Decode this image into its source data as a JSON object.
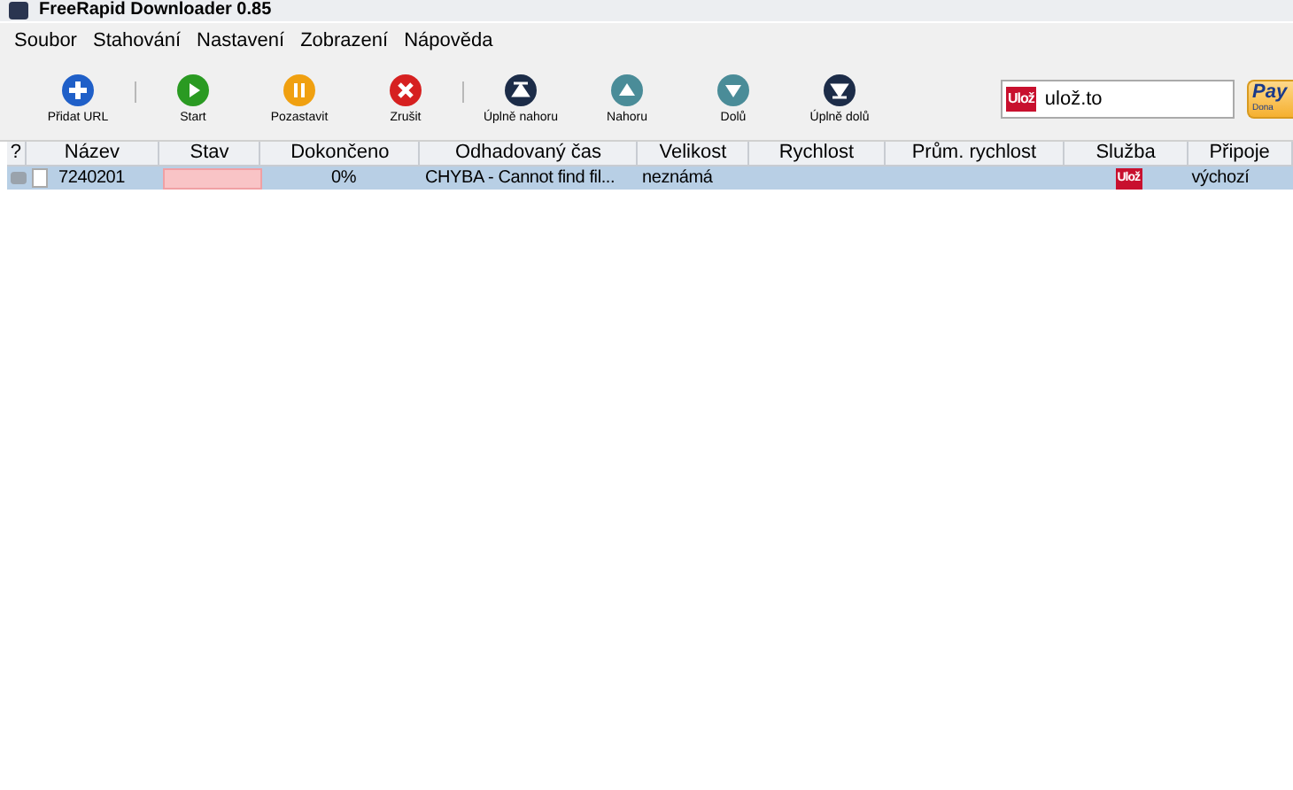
{
  "window": {
    "title": "FreeRapid Downloader 0.85"
  },
  "menu": [
    "Soubor",
    "Stahování",
    "Nastavení",
    "Zobrazení",
    "Nápověda"
  ],
  "toolbar": [
    {
      "kind": "add",
      "label": "Přidat URL",
      "separator_after": true
    },
    {
      "kind": "start",
      "label": "Start",
      "separator_after": false
    },
    {
      "kind": "pause",
      "label": "Pozastavit",
      "separator_after": false
    },
    {
      "kind": "cancel",
      "label": "Zrušit",
      "separator_after": true
    },
    {
      "kind": "top",
      "label": "Úplně nahoru",
      "separator_after": false
    },
    {
      "kind": "up",
      "label": "Nahoru",
      "separator_after": false
    },
    {
      "kind": "down",
      "label": "Dolů",
      "separator_after": false
    },
    {
      "kind": "bottom",
      "label": "Úplně dolů",
      "separator_after": false
    }
  ],
  "service_field": {
    "value": "ulož.to",
    "logo": "Ulož"
  },
  "donate_button": {
    "label": "Pay",
    "sublabel": "Dona"
  },
  "table": {
    "columns": [
      "?",
      "Název",
      "Stav",
      "Dokončeno",
      "Odhadovaný čas",
      "Velikost",
      "Rychlost",
      "Prům. rychlost",
      "Služba",
      "Připoje"
    ],
    "rows": [
      {
        "selected": true,
        "error": true,
        "name": "7240201",
        "completed": "0%",
        "estimate": "CHYBA - Cannot find fil...",
        "size": "neznámá",
        "speed_col": "",
        "service_logo": "Ulož",
        "connection": "výchozí"
      }
    ]
  }
}
